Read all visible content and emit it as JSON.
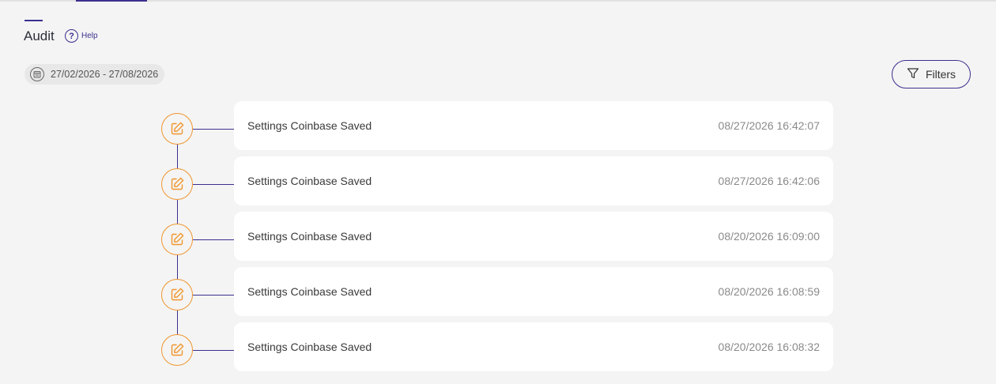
{
  "page": {
    "title": "Audit",
    "help_label": "Help"
  },
  "filters": {
    "date_range": "27/02/2026 - 27/08/2026",
    "filters_label": "Filters"
  },
  "colors": {
    "accent": "#3b2f8f",
    "event_icon": "#f0962e",
    "card": "#ffffff",
    "background": "#f4f4f4"
  },
  "icons": {
    "help": "question-circle-icon",
    "date": "calendar-icon",
    "filters": "funnel-icon",
    "event": "edit-pencil-icon"
  },
  "entries": [
    {
      "message": "Settings Coinbase Saved",
      "timestamp": "08/27/2026 16:42:07"
    },
    {
      "message": "Settings Coinbase Saved",
      "timestamp": "08/27/2026 16:42:06"
    },
    {
      "message": "Settings Coinbase Saved",
      "timestamp": "08/20/2026 16:09:00"
    },
    {
      "message": "Settings Coinbase Saved",
      "timestamp": "08/20/2026 16:08:59"
    },
    {
      "message": "Settings Coinbase Saved",
      "timestamp": "08/20/2026 16:08:32"
    }
  ]
}
